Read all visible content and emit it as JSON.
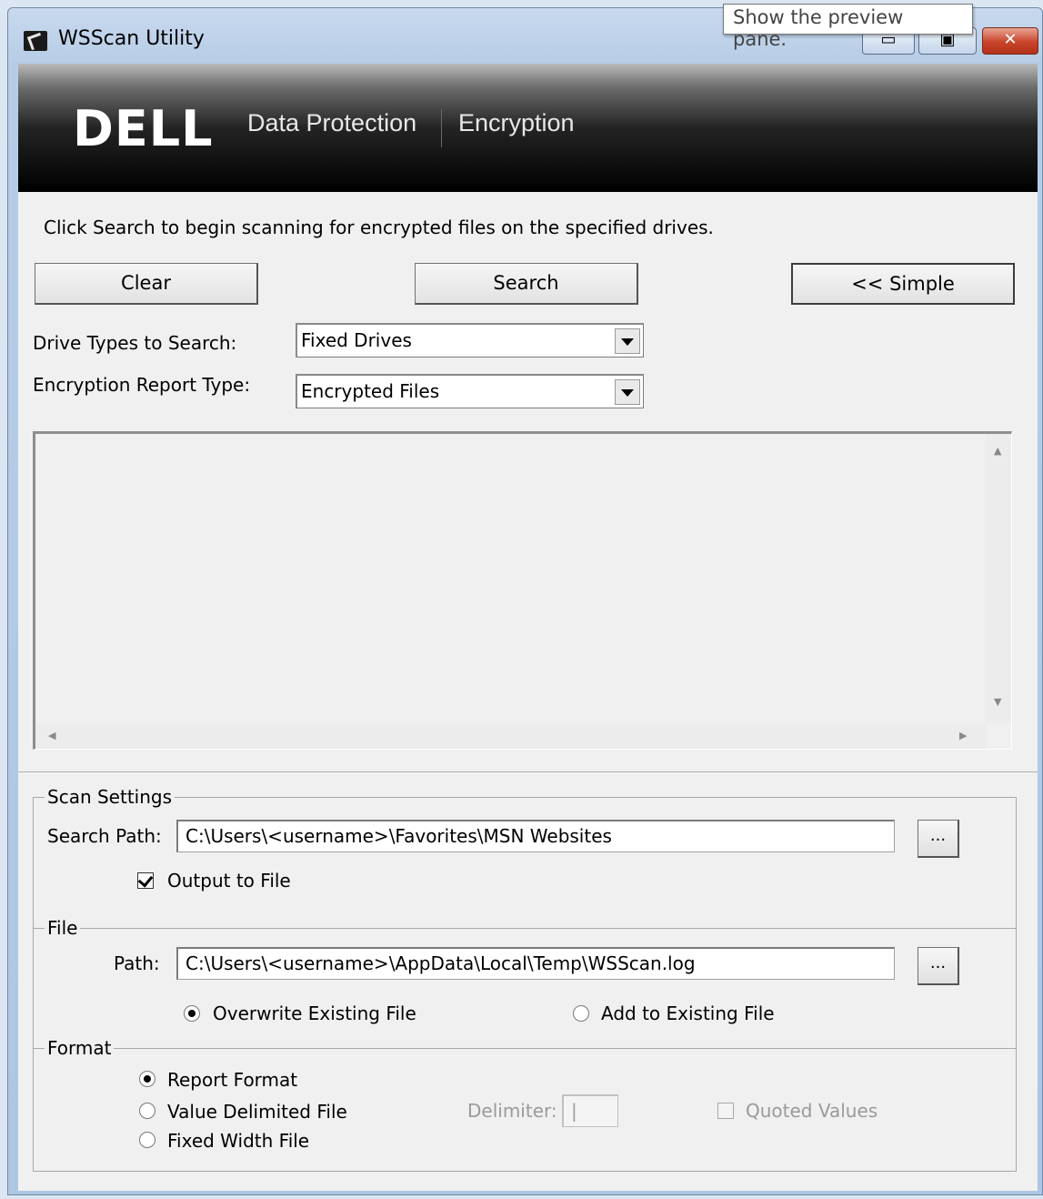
{
  "window": {
    "title": "WSScan Utility",
    "tooltip": "Show the preview pane.",
    "minimize_glyph": "▭",
    "maximize_glyph": "▣",
    "close_glyph": "✕"
  },
  "banner": {
    "logo": "DELL",
    "product": "Data Protection",
    "module": "Encryption"
  },
  "instruction": "Click Search to begin scanning for encrypted files on the specified drives.",
  "buttons": {
    "clear": "Clear",
    "search": "Search",
    "simple": "<<  Simple"
  },
  "drive_types": {
    "label": "Drive Types to Search:",
    "value": "Fixed Drives"
  },
  "report_type": {
    "label": "Encryption Report Type:",
    "value": "Encrypted Files"
  },
  "scan_settings": {
    "legend": "Scan Settings",
    "search_path_label": "Search Path:",
    "search_path": "C:\\Users\\<username>\\Favorites\\MSN Websites",
    "browse": "...",
    "output_to_file": "Output to File",
    "output_checked": true
  },
  "file": {
    "legend": "File",
    "path_label": "Path:",
    "path": "C:\\Users\\<username>\\AppData\\Local\\Temp\\WSScan.log",
    "browse": "...",
    "overwrite": "Overwrite Existing File",
    "add": "Add to Existing File",
    "selected": "overwrite"
  },
  "format": {
    "legend": "Format",
    "report": "Report Format",
    "delimited": "Value Delimited File",
    "fixed": "Fixed Width File",
    "selected": "report",
    "delimiter_label": "Delimiter:",
    "delimiter_value": "|",
    "quoted": "Quoted Values"
  },
  "colors": {
    "banner_bg": "#000000",
    "window_frame": "#b7cde6",
    "close_button": "#c8432a"
  }
}
